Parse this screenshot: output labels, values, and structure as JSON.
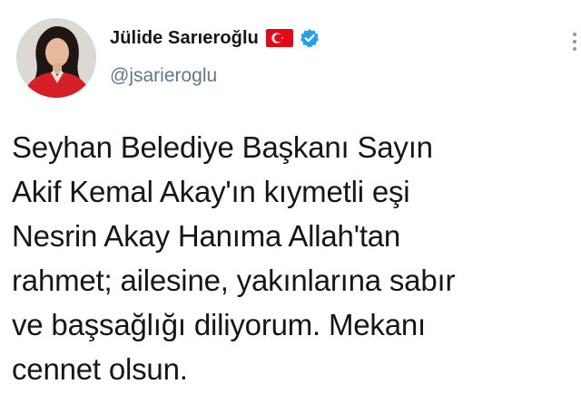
{
  "author": {
    "display_name": "Jülide Sarıeroğlu",
    "handle": "@jsarieroglu",
    "flag_icon": "turkish-flag-icon",
    "verified_icon": "verified-badge-icon"
  },
  "tweet": {
    "text": "Seyhan Belediye Başkanı Sayın\nAkif Kemal Akay'ın kıymetli eşi\nNesrin Akay Hanıma Allah'tan\nrahmet; ailesine, yakınlarına sabır\nve başsağlığı diliyorum. Mekanı\ncennet olsun."
  },
  "colors": {
    "text": "#14171a",
    "secondary": "#657786",
    "verified": "#1da1f2",
    "flag_red": "#e30a17"
  },
  "menu": {
    "icon": "more-options-icon"
  }
}
